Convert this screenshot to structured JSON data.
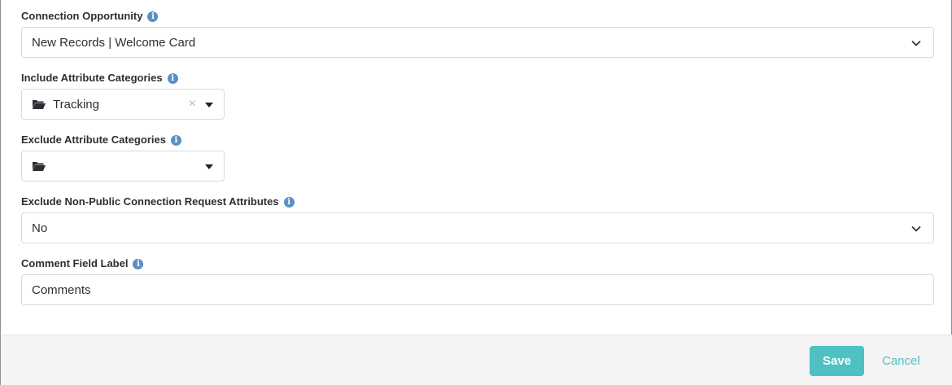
{
  "fields": {
    "connection_opportunity": {
      "label": "Connection Opportunity",
      "value": "New Records | Welcome Card"
    },
    "include_attribute_categories": {
      "label": "Include Attribute Categories",
      "value": "Tracking"
    },
    "exclude_attribute_categories": {
      "label": "Exclude Attribute Categories",
      "value": ""
    },
    "exclude_non_public": {
      "label": "Exclude Non-Public Connection Request Attributes",
      "value": "No"
    },
    "comment_field_label": {
      "label": "Comment Field Label",
      "value": "Comments"
    }
  },
  "footer": {
    "save_label": "Save",
    "cancel_label": "Cancel"
  },
  "icons": {
    "info": "info-icon",
    "folder": "folder-open-icon",
    "chevron": "chevron-down-icon",
    "caret": "caret-down-icon",
    "clear": "clear-icon"
  },
  "colors": {
    "accent": "#4fc1c2",
    "info_icon": "#5a8fc8",
    "footer_bg": "#f4f4f4"
  }
}
